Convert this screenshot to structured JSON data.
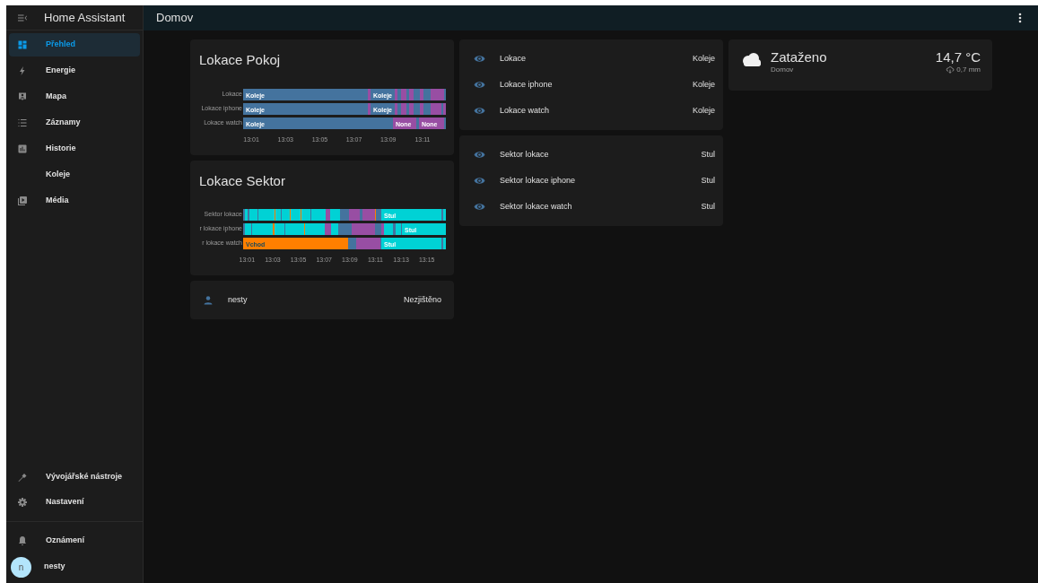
{
  "sidebar": {
    "title": "Home Assistant",
    "items": [
      {
        "label": "Přehled",
        "selected": true
      },
      {
        "label": "Energie",
        "selected": false
      },
      {
        "label": "Mapa",
        "selected": false
      },
      {
        "label": "Záznamy",
        "selected": false
      },
      {
        "label": "Historie",
        "selected": false
      },
      {
        "label": "Koleje",
        "selected": false
      },
      {
        "label": "Média",
        "selected": false
      }
    ],
    "bottom_items": [
      {
        "label": "Vývojářské nástroje",
        "selected": false
      },
      {
        "label": "Nastavení",
        "selected": false
      }
    ],
    "notifications": {
      "label": "Oznámení"
    },
    "user": {
      "initial": "n",
      "name": "nesty"
    }
  },
  "header": {
    "title": "Domov"
  },
  "columns": [
    [
      {
        "kind": "history",
        "title": "Lokace Pokoj",
        "timeline": {
          "time_labels": [
            "13:01",
            "13:03",
            "13:05",
            "13:07",
            "13:09",
            "13:11"
          ],
          "rows": [
            {
              "label": "Lokace",
              "segments": [
                {
                  "color": "#44739e",
                  "label": "Koleje"
                },
                {
                  "color": "#984ea3"
                },
                {
                  "color": "#44739e",
                  "label": "Koleje"
                },
                {
                  "color": "#984ea3"
                },
                {
                  "color": "#44739e"
                },
                {
                  "color": "#984ea3"
                },
                {
                  "color": "#44739e"
                },
                {
                  "color": "#984ea3"
                },
                {
                  "color": "#44739e"
                },
                {
                  "color": "#984ea3"
                },
                {
                  "color": "#44739e"
                },
                {
                  "color": "#984ea3"
                },
                {
                  "color": "#44739e"
                }
              ]
            },
            {
              "label": "Lokace iphone",
              "segments": [
                {
                  "color": "#44739e",
                  "label": "Koleje"
                },
                {
                  "color": "#984ea3"
                },
                {
                  "color": "#44739e",
                  "label": "Koleje"
                },
                {
                  "color": "#984ea3"
                },
                {
                  "color": "#44739e"
                },
                {
                  "color": "#984ea3"
                },
                {
                  "color": "#44739e"
                },
                {
                  "color": "#984ea3"
                },
                {
                  "color": "#44739e"
                },
                {
                  "color": "#984ea3"
                },
                {
                  "color": "#44739e"
                },
                {
                  "color": "#984ea3"
                },
                {
                  "color": "#44739e"
                },
                {
                  "color": "#984ea3"
                }
              ]
            },
            {
              "label": "Lokace watch",
              "segments": [
                {
                  "color": "#44739e",
                  "label": "Koleje"
                },
                {
                  "color": "#984ea3",
                  "label": "None"
                },
                {
                  "color": "#44739e"
                },
                {
                  "color": "#984ea3",
                  "label": "None"
                },
                {
                  "color": "#44739e"
                }
              ]
            }
          ]
        }
      },
      {
        "kind": "history",
        "title": "Lokace Sektor",
        "timeline": {
          "time_labels": [
            "13:01",
            "13:03",
            "13:05",
            "13:07",
            "13:09",
            "13:11",
            "13:13",
            "13:15"
          ],
          "rows": [
            {
              "label": "Sektor lokace",
              "segments": [
                {
                  "color": "#44739e"
                },
                {
                  "color": "#00d2d5"
                },
                {
                  "color": "#44739e"
                },
                {
                  "color": "#00d2d5"
                },
                {
                  "color": "#44739e"
                },
                {
                  "color": "#00d2d5"
                },
                {
                  "color": "#ff7f00"
                },
                {
                  "color": "#00d2d5"
                },
                {
                  "color": "#44739e"
                },
                {
                  "color": "#00d2d5"
                },
                {
                  "color": "#ff7f00"
                },
                {
                  "color": "#00d2d5"
                },
                {
                  "color": "#ff7f00"
                },
                {
                  "color": "#00d2d5"
                },
                {
                  "color": "#44739e"
                },
                {
                  "color": "#00d2d5"
                },
                {
                  "color": "#984ea3"
                },
                {
                  "color": "#00d2d5"
                },
                {
                  "color": "#44739e"
                },
                {
                  "color": "#984ea3"
                },
                {
                  "color": "#44739e"
                },
                {
                  "color": "#984ea3"
                },
                {
                  "color": "#ff7f00"
                },
                {
                  "color": "#44739e"
                },
                {
                  "color": "#00d2d5",
                  "label": "Stul"
                },
                {
                  "color": "#44739e"
                },
                {
                  "color": "#00d2d5"
                }
              ]
            },
            {
              "label": "r lokace iphone",
              "segments": [
                {
                  "color": "#44739e"
                },
                {
                  "color": "#00d2d5"
                },
                {
                  "color": "#44739e"
                },
                {
                  "color": "#00d2d5"
                },
                {
                  "color": "#ff7f00"
                },
                {
                  "color": "#00d2d5"
                },
                {
                  "color": "#44739e"
                },
                {
                  "color": "#00d2d5"
                },
                {
                  "color": "#ff7f00"
                },
                {
                  "color": "#00d2d5"
                },
                {
                  "color": "#984ea3"
                },
                {
                  "color": "#00d2d5"
                },
                {
                  "color": "#44739e"
                },
                {
                  "color": "#984ea3"
                },
                {
                  "color": "#44739e"
                },
                {
                  "color": "#984ea3"
                },
                {
                  "color": "#00d2d5"
                },
                {
                  "color": "#44739e"
                },
                {
                  "color": "#00d2d5"
                },
                {
                  "color": "#44739e"
                },
                {
                  "color": "#00d2d5",
                  "label": "Stul"
                }
              ]
            },
            {
              "label": "r lokace watch",
              "segments": [
                {
                  "color": "#ff7f00",
                  "label": "Vchod"
                },
                {
                  "color": "#44739e"
                },
                {
                  "color": "#984ea3"
                },
                {
                  "color": "#44739e"
                },
                {
                  "color": "#00d2d5",
                  "label": "Stul"
                },
                {
                  "color": "#44739e"
                },
                {
                  "color": "#00d2d5"
                }
              ]
            }
          ]
        }
      },
      {
        "kind": "person",
        "name": "nesty",
        "state": "Nezjištěno"
      }
    ],
    [
      {
        "kind": "entities",
        "rows": [
          {
            "name": "Lokace",
            "state": "Koleje"
          },
          {
            "name": "Lokace iphone",
            "state": "Koleje"
          },
          {
            "name": "Lokace watch",
            "state": "Koleje"
          }
        ]
      },
      {
        "kind": "entities",
        "rows": [
          {
            "name": "Sektor lokace",
            "state": "Stul"
          },
          {
            "name": "Sektor lokace iphone",
            "state": "Stul"
          },
          {
            "name": "Sektor lokace watch",
            "state": "Stul"
          }
        ]
      }
    ],
    [
      {
        "kind": "weather",
        "condition": "Zataženo",
        "location": "Domov",
        "temperature": "14,7 °C",
        "precipitation": "0,7 mm"
      }
    ]
  ]
}
